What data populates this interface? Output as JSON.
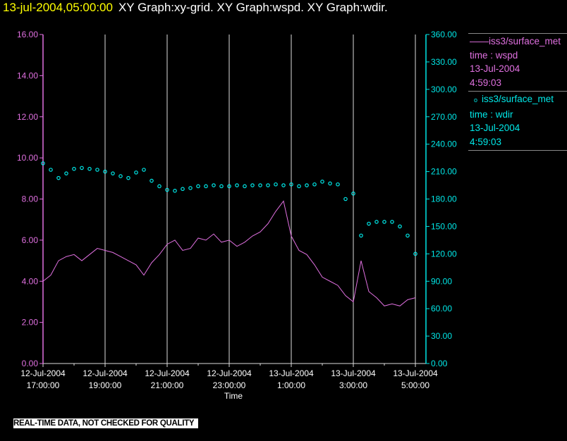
{
  "header": {
    "timestamp": "13-jul-2004,05:00:00",
    "graphs": "XY Graph:xy-grid.  XY Graph:wspd.  XY Graph:wdir."
  },
  "legend": [
    {
      "symbol": "line",
      "name": "iss3/surface_met",
      "vars": "time : wspd",
      "date": "13-Jul-2004",
      "time": "4:59:03",
      "color": "#e070e0"
    },
    {
      "symbol": "circle",
      "name": "iss3/surface_met",
      "vars": "time : wdir",
      "date": "13-Jul-2004",
      "time": "4:59:03",
      "color": "#00e8e8"
    }
  ],
  "warning": "REAL-TIME DATA, NOT CHECKED FOR QUALITY",
  "chart_data": {
    "type": "line",
    "xlabel": "Time",
    "grid": "vertical",
    "x_ticks": [
      {
        "date": "12-Jul-2004",
        "time": "17:00:00"
      },
      {
        "date": "12-Jul-2004",
        "time": "19:00:00"
      },
      {
        "date": "12-Jul-2004",
        "time": "21:00:00"
      },
      {
        "date": "12-Jul-2004",
        "time": "23:00:00"
      },
      {
        "date": "13-Jul-2004",
        "time": "1:00:00"
      },
      {
        "date": "13-Jul-2004",
        "time": "3:00:00"
      },
      {
        "date": "13-Jul-2004",
        "time": "5:00:00"
      }
    ],
    "xlim": [
      "12-Jul-2004 17:00",
      "13-Jul-2004 05:20"
    ],
    "y_left": {
      "ylim": [
        0,
        16
      ],
      "ticks": [
        "0.00",
        "2.00",
        "4.00",
        "6.00",
        "8.00",
        "10.00",
        "12.00",
        "14.00",
        "16.00"
      ],
      "color": "#e070e0"
    },
    "y_right": {
      "ylim": [
        0,
        360
      ],
      "ticks": [
        "0.00",
        "30.00",
        "60.00",
        "90.00",
        "120.00",
        "150.00",
        "180.00",
        "210.00",
        "240.00",
        "270.00",
        "300.00",
        "330.00",
        "360.00"
      ],
      "color": "#00e8e8"
    },
    "x": [
      "17:00",
      "17:15",
      "17:30",
      "17:45",
      "18:00",
      "18:15",
      "18:30",
      "18:45",
      "19:00",
      "19:15",
      "19:30",
      "19:45",
      "20:00",
      "20:15",
      "20:30",
      "20:45",
      "21:00",
      "21:15",
      "21:30",
      "21:45",
      "22:00",
      "22:15",
      "22:30",
      "22:45",
      "23:00",
      "23:15",
      "23:30",
      "23:45",
      "00:00",
      "00:15",
      "00:30",
      "00:45",
      "01:00",
      "01:15",
      "01:30",
      "01:45",
      "02:00",
      "02:15",
      "02:30",
      "02:45",
      "03:00",
      "03:15",
      "03:30",
      "03:45",
      "04:00",
      "04:15",
      "04:30",
      "04:45",
      "05:00"
    ],
    "series": [
      {
        "axis": "left",
        "style": "line",
        "values": [
          4.0,
          4.3,
          5.0,
          5.2,
          5.3,
          5.0,
          5.3,
          5.6,
          5.5,
          5.4,
          5.2,
          5.0,
          4.8,
          4.3,
          4.9,
          5.3,
          5.8,
          6.0,
          5.5,
          5.6,
          6.1,
          6.0,
          6.3,
          5.9,
          6.0,
          5.7,
          5.9,
          6.2,
          6.4,
          6.8,
          7.4,
          7.9,
          6.2,
          5.5,
          5.3,
          4.8,
          4.2,
          4.0,
          3.8,
          3.3,
          3.0,
          5.0,
          3.5,
          3.2,
          2.8,
          2.9,
          2.8,
          3.1,
          3.2
        ]
      },
      {
        "axis": "right",
        "style": "circle",
        "values": [
          219,
          212,
          203,
          208,
          213,
          214,
          213,
          212,
          210,
          208,
          205,
          203,
          209,
          212,
          200,
          194,
          190,
          189,
          191,
          192,
          194,
          194,
          195,
          194,
          194,
          195,
          194,
          195,
          195,
          195,
          196,
          195,
          196,
          194,
          195,
          196,
          199,
          197,
          196,
          180,
          186,
          140,
          153,
          155,
          155,
          155,
          150,
          140,
          120
        ]
      }
    ]
  }
}
